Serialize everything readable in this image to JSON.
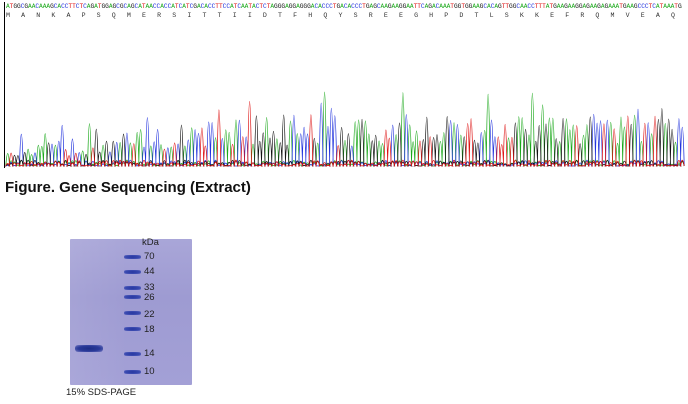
{
  "sequencing": {
    "dna_sequence": "ATGGCGAACAAAGCACCTTCTCAGATGGAGCGCAGCATAACCACCATCATCGACACCTTCCATCAATACTCTAGGGAGGAGGGACACCCTGACACCCTGAGCAAGAAGGAATTCAGACAAATGGTGGAAGCACAGTTGGCAACCTTTATGAAGAAGGAGAAGAGAAATGAAGCCCTCATAAATGACATCATGGAGGACC",
    "amino_acids": "M A N K A P S Q M E R S I T T I I D T F H Q Y S R E E G H P D T L S K K E F R Q M V E A Q L A T F M K K E K R N E A L I N D I M E D L",
    "base_colors": {
      "A": "#1aa81a",
      "C": "#2233dd",
      "G": "#111111",
      "T": "#dd1111"
    }
  },
  "figure_caption": "Figure. Gene Sequencing (Extract)",
  "gel": {
    "unit_label": "kDa",
    "markers": [
      "70",
      "44",
      "33",
      "26",
      "22",
      "18",
      "14",
      "10"
    ],
    "caption": "15% SDS-PAGE"
  }
}
